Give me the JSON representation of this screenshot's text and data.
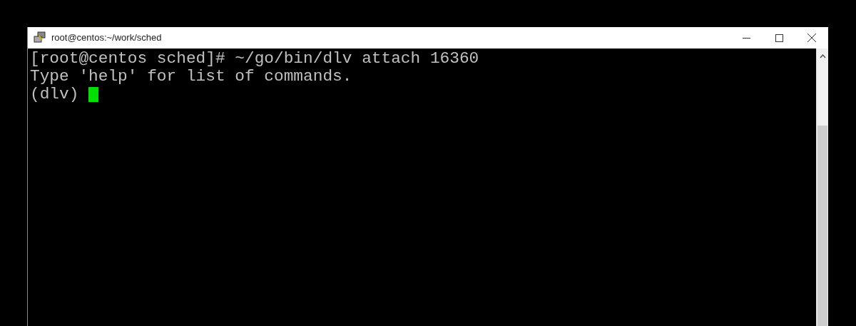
{
  "window": {
    "title": "root@centos:~/work/sched"
  },
  "terminal": {
    "lines": [
      "[root@centos sched]# ~/go/bin/dlv attach 16360",
      "Type 'help' for list of commands.",
      "(dlv) "
    ]
  }
}
